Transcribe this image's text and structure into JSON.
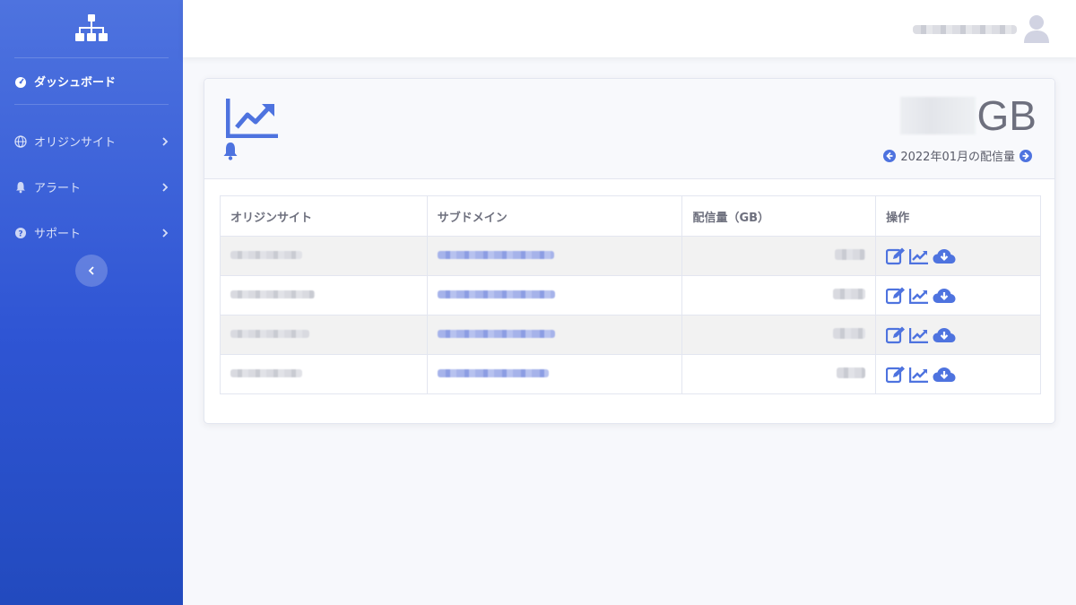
{
  "sidebar": {
    "brand_icon": "sitemap-icon",
    "items": [
      {
        "label": "ダッシュボード",
        "icon": "tachometer-icon",
        "active": true
      },
      {
        "label": "オリジンサイト",
        "icon": "globe-icon",
        "active": false
      },
      {
        "label": "アラート",
        "icon": "bell-icon",
        "active": false
      },
      {
        "label": "サポート",
        "icon": "question-circle-icon",
        "active": false
      }
    ],
    "collapse_icon": "chevron-left-icon"
  },
  "topbar": {
    "user_icon": "user-icon"
  },
  "summary": {
    "usage_unit": "GB",
    "period_label": "2022年01月の配信量",
    "prev_icon": "arrow-circle-left-icon",
    "next_icon": "arrow-circle-right-icon"
  },
  "table": {
    "headers": [
      "オリジンサイト",
      "サブドメイン",
      "配信量（GB）",
      "操作"
    ],
    "rows": [
      {
        "striped": true
      },
      {
        "striped": false
      },
      {
        "striped": true
      },
      {
        "striped": false
      }
    ],
    "actions": [
      "edit-icon",
      "chart-line-icon",
      "cloud-download-icon"
    ]
  },
  "colors": {
    "primary": "#4e73df",
    "sidebar_bottom": "#224abe",
    "text": "#5a5c69"
  }
}
